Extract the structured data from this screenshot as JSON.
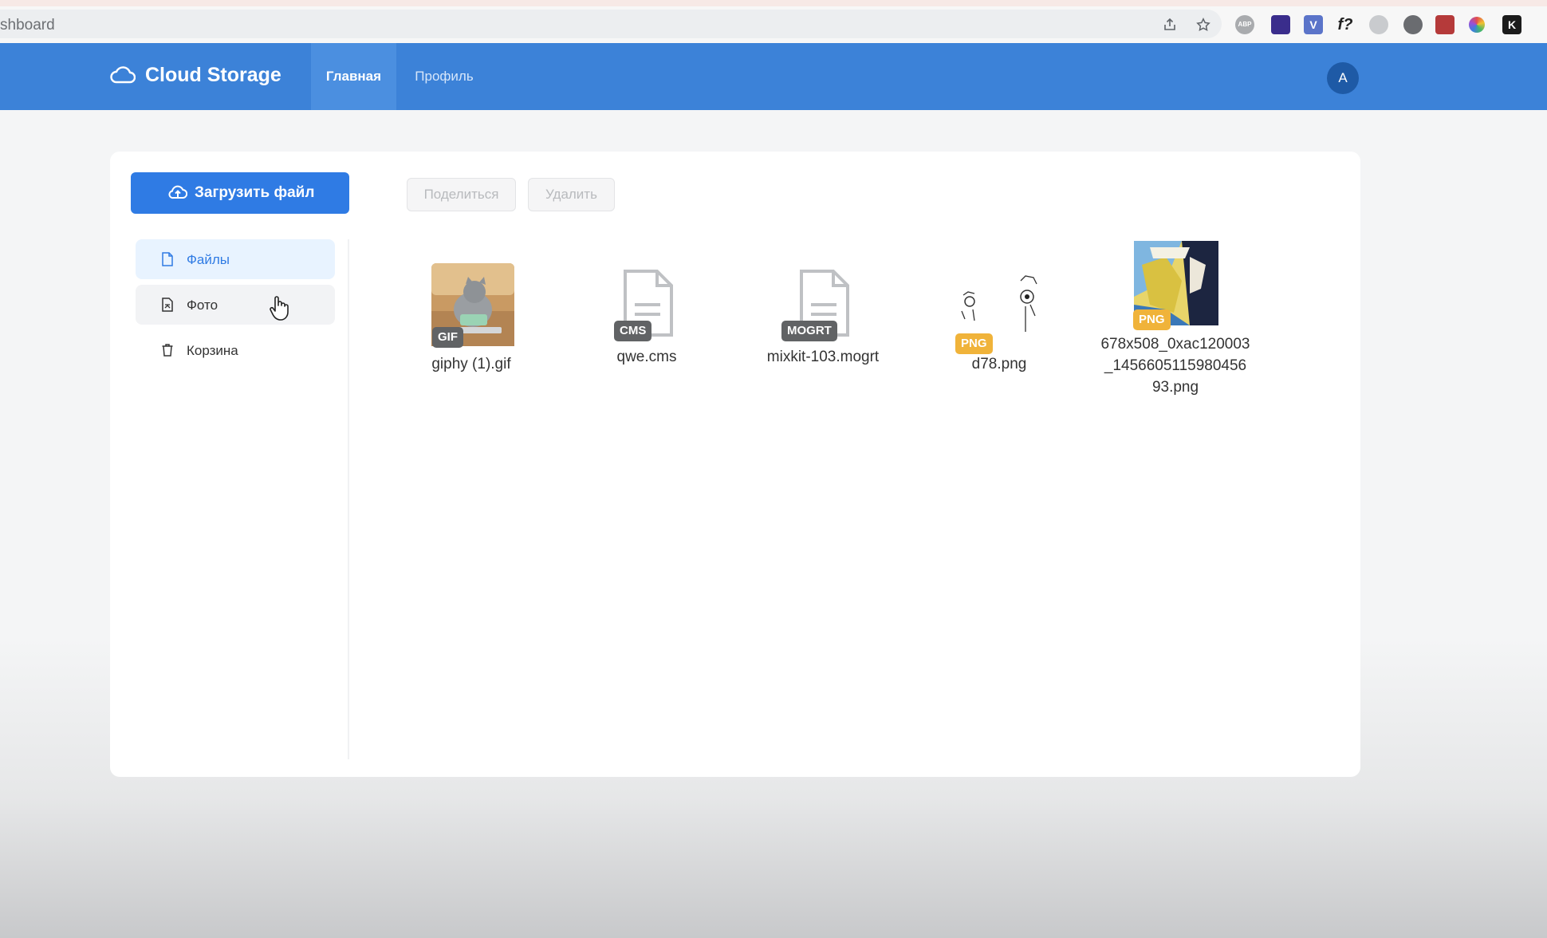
{
  "browser": {
    "url": "shboard",
    "extensions": [
      {
        "name": "abp",
        "label": "ABP",
        "color": "#a9abae"
      },
      {
        "name": "gem",
        "label": "",
        "color": "#3a2d8c"
      },
      {
        "name": "v-ext",
        "label": "V",
        "color": "#5b74c9"
      },
      {
        "name": "f-ext",
        "label": "f?",
        "color": "#222222"
      },
      {
        "name": "shield",
        "label": "",
        "color": "#c9cbce"
      },
      {
        "name": "circle-ext",
        "label": "",
        "color": "#6a6c70"
      },
      {
        "name": "red-ext",
        "label": "",
        "color": "#b53a3a"
      },
      {
        "name": "color-wheel",
        "label": "",
        "color": "#e24d4d"
      },
      {
        "name": "k-ext",
        "label": "K",
        "color": "#1b1b1b"
      }
    ]
  },
  "header": {
    "logo_text": "Cloud Storage",
    "tabs": [
      {
        "label": "Главная",
        "active": true
      },
      {
        "label": "Профиль",
        "active": false
      }
    ],
    "avatar_letter": "A"
  },
  "sidebar": {
    "upload_label": "Загрузить файл",
    "items": [
      {
        "label": "Файлы",
        "icon": "file-icon",
        "active": true
      },
      {
        "label": "Фото",
        "icon": "photo-file-icon",
        "active": false
      },
      {
        "label": "Корзина",
        "icon": "trash-icon",
        "active": false
      }
    ]
  },
  "toolbar": {
    "share_label": "Поделиться",
    "delete_label": "Удалить"
  },
  "files": [
    {
      "name": "giphy (1).gif",
      "badge": "GIF",
      "kind": "image"
    },
    {
      "name": "qwe.cms",
      "badge": "CMS",
      "kind": "document"
    },
    {
      "name": "mixkit-103.mogrt",
      "badge": "MOGRT",
      "kind": "document"
    },
    {
      "name": "d78.png",
      "badge": "PNG",
      "kind": "image"
    },
    {
      "name": "678x508_0xac120003_1456605115980456 93.png",
      "name_lines": [
        "678x508_0xac120003",
        "_1456605115980456",
        "93.png"
      ],
      "badge": "PNG",
      "kind": "image"
    }
  ],
  "colors": {
    "header_bg": "#3c82d8",
    "primary": "#2f7be4",
    "badge_gray": "#616365",
    "badge_orange": "#f0b33a"
  }
}
